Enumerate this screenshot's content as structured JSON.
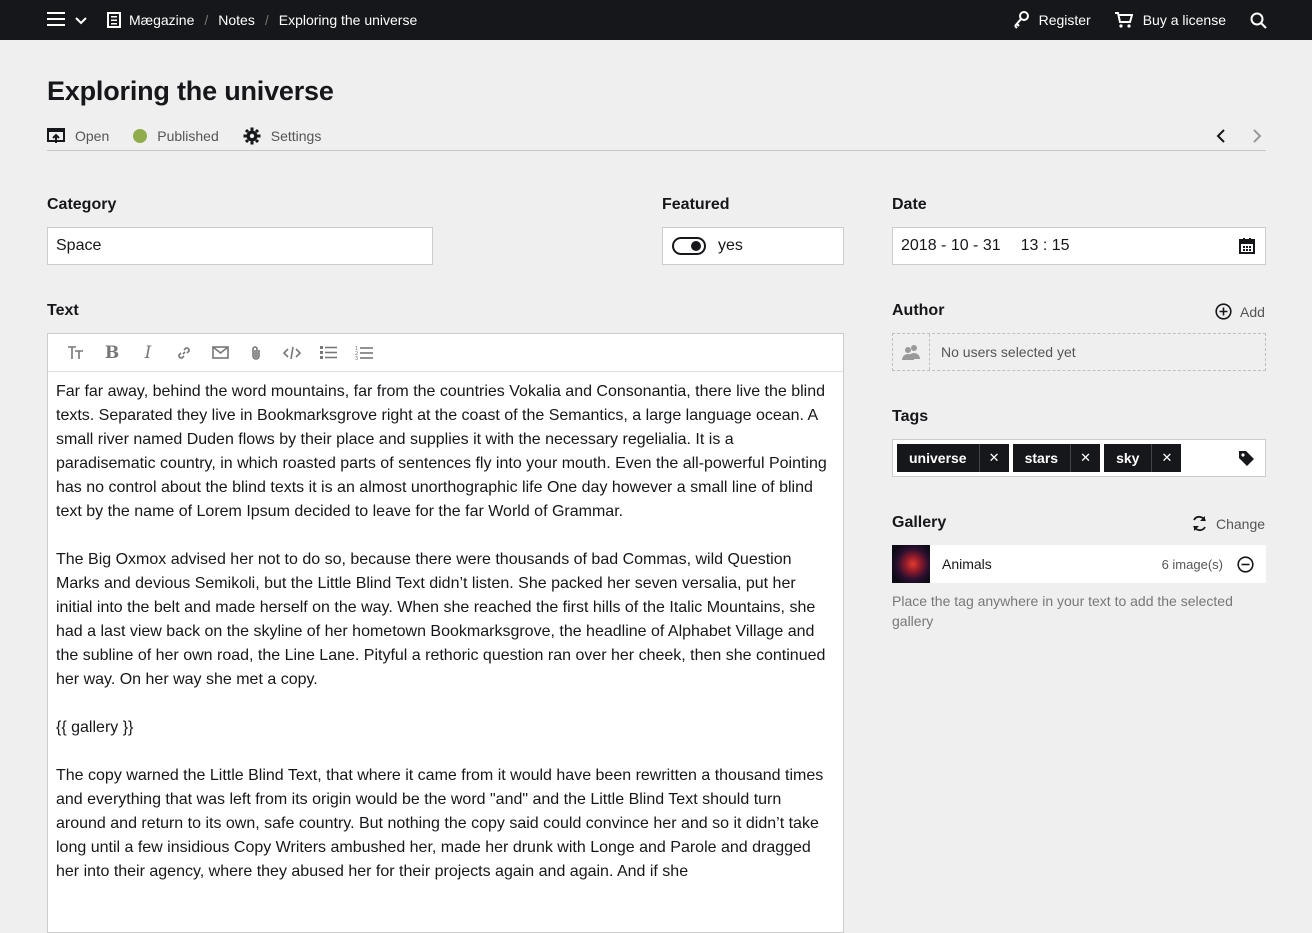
{
  "topbar": {
    "breadcrumbs": [
      "Mægazine",
      "Notes",
      "Exploring the universe"
    ],
    "register_label": "Register",
    "license_label": "Buy a license"
  },
  "page": {
    "title": "Exploring the universe",
    "open_label": "Open",
    "status_label": "Published",
    "settings_label": "Settings",
    "status_color": "#8fad4c"
  },
  "fields": {
    "category_label": "Category",
    "category_value": "Space",
    "featured_label": "Featured",
    "featured_value": "yes",
    "date_label": "Date",
    "date_value": "2018 - 10 - 31",
    "time_value": "13 : 15",
    "text_label": "Text"
  },
  "editor": {
    "tools": [
      "headings-icon",
      "bold-icon",
      "italic-icon",
      "link-icon",
      "email-icon",
      "attachment-icon",
      "code-icon",
      "bullet-list-icon",
      "ordered-list-icon"
    ],
    "paragraphs": [
      "Far far away, behind the word mountains, far from the countries Vokalia and Consonantia, there live the blind texts. Separated they live in Bookmarksgrove right at the coast of the Semantics, a large language ocean. A small river named Duden flows by their place and supplies it with the necessary regelialia. It is a paradisematic country, in which roasted parts of sentences fly into your mouth. Even the all-powerful Pointing has no control about the blind texts it is an almost unorthographic life One day however a small line of blind text by the name of Lorem Ipsum decided to leave for the far World of Grammar.",
      "The Big Oxmox advised her not to do so, because there were thousands of bad Commas, wild Question Marks and devious Semikoli, but the Little Blind Text didn’t listen. She packed her seven versalia, put her initial into the belt and made herself on the way. When she reached the first hills of the Italic Mountains, she had a last view back on the skyline of her hometown Bookmarksgrove, the headline of Alphabet Village and the subline of her own road, the Line Lane. Pityful a rethoric question ran over her cheek, then she continued her way. On her way she met a copy.",
      "{{ gallery }}",
      "The copy warned the Little Blind Text, that where it came from it would have been rewritten a thousand times and everything that was left from its origin would be the word \"and\" and the Little Blind Text should turn around and return to its own, safe country. But nothing the copy said could convince her and so it didn’t take long until a few insidious Copy Writers ambushed her, made her drunk with Longe and Parole and dragged her into their agency, where they abused her for their projects again and again. And if she"
    ]
  },
  "author": {
    "label": "Author",
    "add_label": "Add",
    "empty_text": "No users selected yet"
  },
  "tags": {
    "label": "Tags",
    "items": [
      "universe",
      "stars",
      "sky"
    ]
  },
  "gallery": {
    "label": "Gallery",
    "change_label": "Change",
    "item_name": "Animals",
    "item_count": "6 image(s)",
    "help": "Place the tag anywhere in your text to add the selected gallery"
  }
}
